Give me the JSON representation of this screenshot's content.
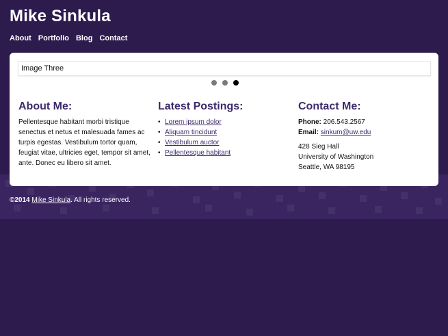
{
  "site": {
    "title": "Mike Sinkula"
  },
  "nav": {
    "items": [
      {
        "label": "About"
      },
      {
        "label": "Portfolio"
      },
      {
        "label": "Blog"
      },
      {
        "label": "Contact"
      }
    ]
  },
  "carousel": {
    "current_label": "Image Three",
    "dots_total": 3,
    "active_index": 2
  },
  "about": {
    "heading": "About Me:",
    "text": "Pellentesque habitant morbi tristique senectus et netus et malesuada fames ac turpis egestas. Vestibulum tortor quam, feugiat vitae, ultricies eget, tempor sit amet, ante. Donec eu libero sit amet."
  },
  "postings": {
    "heading": "Latest Postings:",
    "items": [
      {
        "label": "Lorem ipsum dolor"
      },
      {
        "label": "Aliquam tincidunt"
      },
      {
        "label": "Vestibulum auctor"
      },
      {
        "label": "Pellentesque habitant"
      }
    ]
  },
  "contact": {
    "heading": "Contact Me:",
    "phone_label": "Phone:",
    "phone": "206.543.2567",
    "email_label": "Email:",
    "email": "sinkum@uw.edu",
    "address_line1": "428 Sieg Hall",
    "address_line2": "University of Washington",
    "address_line3": "Seattle, WA 98195"
  },
  "footer": {
    "copyright": "©2014",
    "name_link": "Mike Sinkula",
    "rights": ". All rights reserved."
  },
  "colors": {
    "background": "#2e1b4e",
    "accent_purple": "#3d2a6b",
    "card": "#ffffff"
  }
}
